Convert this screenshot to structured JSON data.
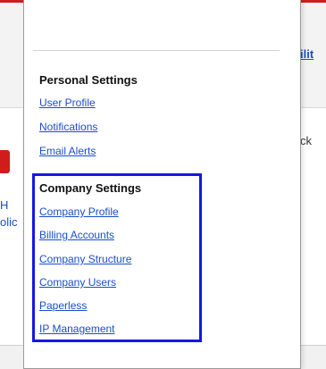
{
  "background": {
    "top_right_link": "ilit",
    "right_text": "ck",
    "left_text_1": "H",
    "left_text_2": "olic"
  },
  "personal": {
    "heading": "Personal Settings",
    "items": [
      {
        "label": "User Profile"
      },
      {
        "label": "Notifications"
      },
      {
        "label": "Email Alerts"
      }
    ]
  },
  "company": {
    "heading": "Company Settings",
    "items": [
      {
        "label": "Company Profile"
      },
      {
        "label": "Billing Accounts"
      },
      {
        "label": "Company Structure"
      },
      {
        "label": "Company Users"
      },
      {
        "label": "Paperless"
      },
      {
        "label": "IP Management"
      }
    ]
  },
  "colors": {
    "link": "#1a4ec8",
    "highlight_border": "#1616e8",
    "brand_red": "#cc1f1f"
  }
}
